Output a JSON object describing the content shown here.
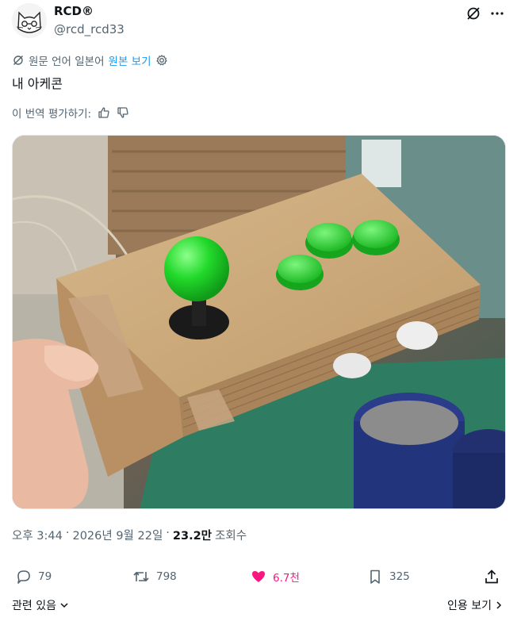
{
  "post": {
    "display_name": "RCD®",
    "handle": "@rcd_rcd33",
    "translated_from": "원문 언어 일본어",
    "show_original": "원본 보기",
    "text": "내 아케콘",
    "rate_translation": "이 번역 평가하기:",
    "time": "오후 3:44",
    "date": "2026년 9월 22일",
    "views_count": "23.2만",
    "views_label": "조회수"
  },
  "actions": {
    "replies": "79",
    "reposts": "798",
    "likes": "6.7천",
    "bookmarks": "325"
  },
  "footer": {
    "related": "관련 있음",
    "view_quotes": "인용 보기"
  },
  "colors": {
    "link": "#1d9bf0",
    "like": "#f91880",
    "muted": "#536471",
    "text": "#0f1419"
  },
  "icons": [
    "cat-avatar",
    "grok-icon",
    "more-icon",
    "translate-icon",
    "gear-icon",
    "thumbs-up-icon",
    "thumbs-down-icon",
    "reply-icon",
    "repost-icon",
    "heart-icon",
    "bookmark-icon",
    "share-icon",
    "chevron-down-icon",
    "chevron-right-icon"
  ]
}
